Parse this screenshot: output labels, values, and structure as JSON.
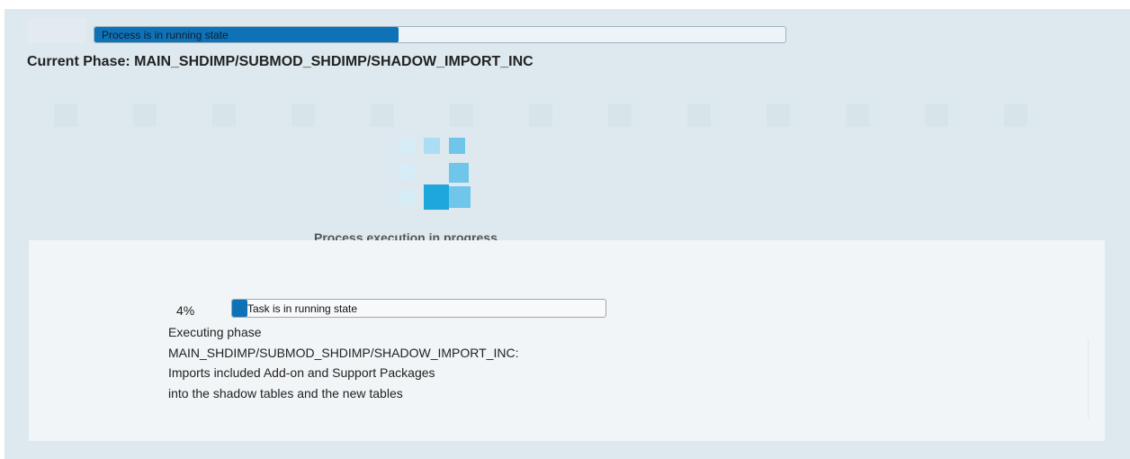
{
  "header": {
    "progress_label": "Process is in running state",
    "progress_fraction": 0.44,
    "current_phase": "Current Phase: MAIN_SHDIMP/SUBMOD_SHDIMP/SHADOW_IMPORT_INC"
  },
  "busy": {
    "text": "Process execution in progress"
  },
  "task": {
    "percent_text": "4%",
    "progress_label": "Task is in running state",
    "progress_fraction": 0.04,
    "lines": [
      "Executing phase",
      "MAIN_SHDIMP/SUBMOD_SHDIMP/SHADOW_IMPORT_INC:",
      "Imports included Add-on and Support Packages",
      "into the shadow tables and the new tables"
    ]
  },
  "colors": {
    "progress_fill": "#0f72b6",
    "busy_dark": "#1ea7dc",
    "busy_mid": "#6fc5ea",
    "busy_light": "#aedcf2",
    "busy_empty": "#d6ecf6"
  }
}
